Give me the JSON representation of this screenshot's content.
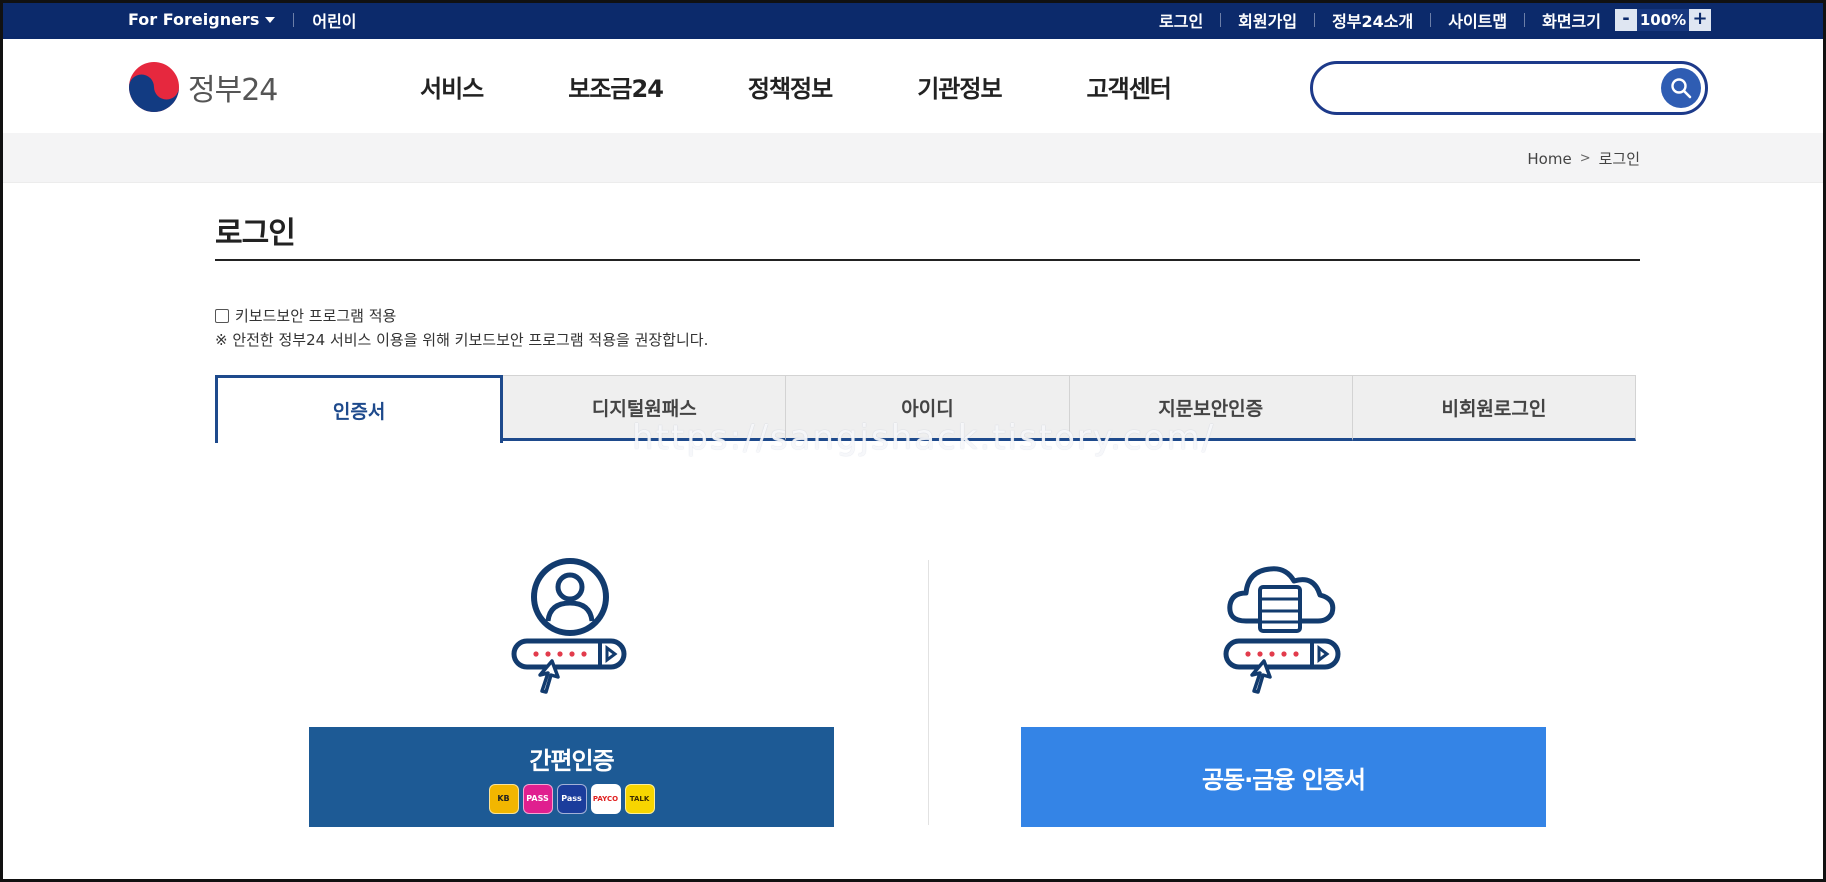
{
  "util_bar": {
    "foreigners": "For Foreigners",
    "kids": "어린이",
    "links": [
      "로그인",
      "회원가입",
      "정부24소개",
      "사이트맵"
    ],
    "screen_size_label": "화면크기",
    "zoom_minus": "-",
    "zoom_value": "100%",
    "zoom_plus": "+"
  },
  "header": {
    "logo_text": "정부24",
    "nav": [
      "서비스",
      "보조금24",
      "정책정보",
      "기관정보",
      "고객센터"
    ],
    "search_placeholder": ""
  },
  "breadcrumb": {
    "home": "Home",
    "current": "로그인"
  },
  "page": {
    "title": "로그인",
    "keyboard_security_label": "키보드보안 프로그램 적용",
    "keyboard_security_checked": false,
    "keyboard_security_note": "※ 안전한 정부24 서비스 이용을 위해 키보드보안 프로그램 적용을 권장합니다.",
    "tabs": [
      "인증서",
      "디지털원패스",
      "아이디",
      "지문보안인증",
      "비회원로그인"
    ],
    "active_tab": "인증서",
    "watermark": "https://sangjshack.tistory.com/"
  },
  "login_options": {
    "simple_auth_label": "간편인증",
    "simple_auth_apps": [
      {
        "name": "KB",
        "label": "KB",
        "color": "#f2b600"
      },
      {
        "name": "PASS",
        "label": "PASS",
        "color": "#e01f8f"
      },
      {
        "name": "Samsung Pass",
        "label": "Pass",
        "color": "#1b3d9c"
      },
      {
        "name": "PAYCO",
        "label": "PAYCO",
        "color": "#ffffff"
      },
      {
        "name": "Kakao",
        "label": "TALK",
        "color": "#f7d500"
      }
    ],
    "joint_cert_label": "공동·금융 인증서"
  },
  "colors": {
    "top_bar": "#0c2a6b",
    "primary_dark": "#1d5a95",
    "primary_light": "#3484e6",
    "tab_active": "#1e4a8c"
  }
}
